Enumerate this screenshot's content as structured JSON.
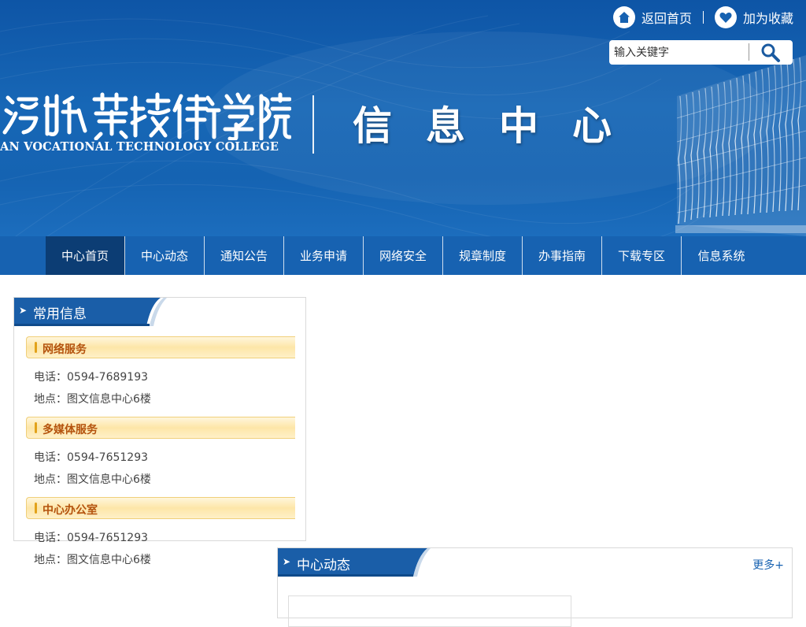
{
  "header": {
    "home_link": "返回首页",
    "favorite_link": "加为收藏",
    "search": {
      "placeholder": "输入关键字",
      "icon": "search-icon"
    },
    "logo_cn": "湄洲湾职业技术学院",
    "logo_en": "AN VOCATIONAL TECHNOLOGY COLLEGE",
    "site_title": "信息中心"
  },
  "nav": {
    "items": [
      {
        "label": "中心首页",
        "active": true
      },
      {
        "label": "中心动态"
      },
      {
        "label": "通知公告"
      },
      {
        "label": "业务申请"
      },
      {
        "label": "网络安全"
      },
      {
        "label": "规章制度"
      },
      {
        "label": "办事指南"
      },
      {
        "label": "下载专区"
      },
      {
        "label": "信息系统"
      }
    ]
  },
  "common_info": {
    "title": "常用信息",
    "sections": [
      {
        "name": "网络服务",
        "phone": "电话：0594-7689193",
        "location": "地点：图文信息中心6楼"
      },
      {
        "name": "多媒体服务",
        "phone": "电话：0594-7651293",
        "location": "地点：图文信息中心6楼"
      },
      {
        "name": "中心办公室",
        "phone": "电话：0594-7651293",
        "location": "地点：图文信息中心6楼"
      }
    ]
  },
  "news": {
    "title": "中心动态",
    "more": "更多+"
  },
  "colors": {
    "banner_blue": "#1563b2",
    "nav_blue": "#1762b1",
    "nav_active": "#0c3d74",
    "section_text": "#b4530e"
  }
}
